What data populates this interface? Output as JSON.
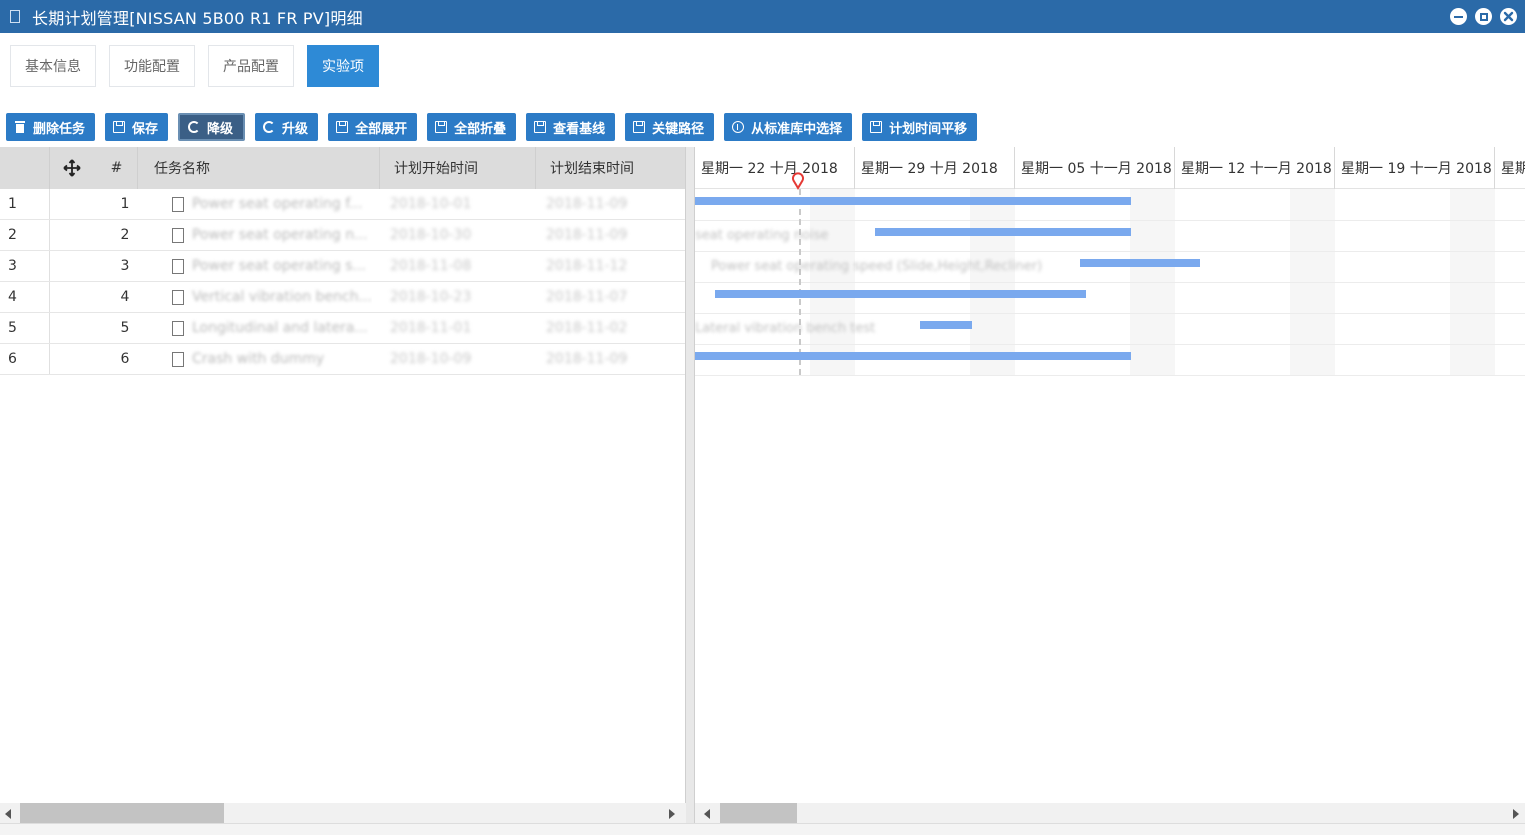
{
  "window": {
    "title": "长期计划管理[NISSAN  5B00  R1  FR  PV]明细"
  },
  "tabs": [
    {
      "label": "基本信息",
      "active": false
    },
    {
      "label": "功能配置",
      "active": false
    },
    {
      "label": "产品配置",
      "active": false
    },
    {
      "label": "实验项",
      "active": true
    }
  ],
  "toolbar": {
    "buttons": [
      {
        "label": "删除任务",
        "icon": "trash-icon"
      },
      {
        "label": "保存",
        "icon": "save-icon"
      },
      {
        "label": "降级",
        "icon": "refresh-icon"
      },
      {
        "label": "升级",
        "icon": "refresh-icon"
      },
      {
        "label": "全部展开",
        "icon": "save-icon"
      },
      {
        "label": "全部折叠",
        "icon": "save-icon"
      },
      {
        "label": "查看基线",
        "icon": "save-icon"
      },
      {
        "label": "关键路径",
        "icon": "save-icon"
      },
      {
        "label": "从标准库中选择",
        "icon": "info-icon"
      },
      {
        "label": "计划时间平移",
        "icon": "save-icon"
      }
    ]
  },
  "grid": {
    "columns": {
      "move": "move-icon",
      "index": "#",
      "name": "任务名称",
      "start": "计划开始时间",
      "end": "计划结束时间"
    },
    "rows": [
      {
        "rownum": "1",
        "index": "1",
        "name": "Power seat operating f...",
        "start": "2018-10-01",
        "end": "2018-11-09"
      },
      {
        "rownum": "2",
        "index": "2",
        "name": "Power seat operating n...",
        "start": "2018-10-30",
        "end": "2018-11-09"
      },
      {
        "rownum": "3",
        "index": "3",
        "name": "Power seat operating s...",
        "start": "2018-11-08",
        "end": "2018-11-12"
      },
      {
        "rownum": "4",
        "index": "4",
        "name": "Vertical vibration bench...",
        "start": "2018-10-23",
        "end": "2018-11-07"
      },
      {
        "rownum": "5",
        "index": "5",
        "name": "Longitudinal and latera...",
        "start": "2018-11-01",
        "end": "2018-11-02"
      },
      {
        "rownum": "6",
        "index": "6",
        "name": "Crash with dummy",
        "start": "2018-10-09",
        "end": "2018-11-09"
      }
    ]
  },
  "gantt": {
    "weeks": [
      "星期一 22 十月 2018",
      "星期一 29 十月 2018",
      "星期一 05 十一月 2018",
      "星期一 12 十一月 2018",
      "星期一 19 十一月 2018",
      "星期"
    ],
    "bar_labels": [
      "",
      "seat operating noise",
      "Power seat operating speed (Slide,Height,Recliner)",
      "",
      "Lateral vibration bench test",
      ""
    ],
    "bar_color": "#7aa9ee"
  }
}
